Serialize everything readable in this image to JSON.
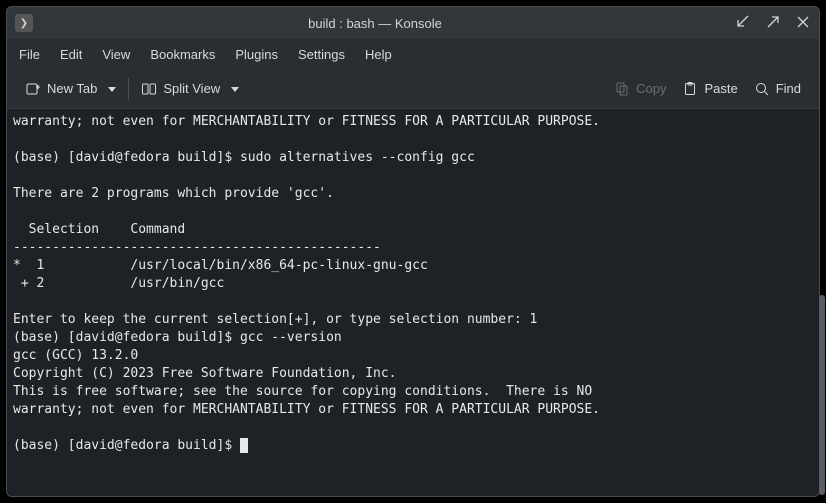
{
  "window": {
    "title": "build : bash — Konsole"
  },
  "menubar": {
    "items": [
      "File",
      "Edit",
      "View",
      "Bookmarks",
      "Plugins",
      "Settings",
      "Help"
    ]
  },
  "toolbar": {
    "new_tab": "New Tab",
    "split_view": "Split View",
    "copy": "Copy",
    "paste": "Paste",
    "find": "Find"
  },
  "terminal": {
    "lines": [
      "warranty; not even for MERCHANTABILITY or FITNESS FOR A PARTICULAR PURPOSE.",
      "",
      "(base) [david@fedora build]$ sudo alternatives --config gcc",
      "",
      "There are 2 programs which provide 'gcc'.",
      "",
      "  Selection    Command",
      "-----------------------------------------------",
      "*  1           /usr/local/bin/x86_64-pc-linux-gnu-gcc",
      " + 2           /usr/bin/gcc",
      "",
      "Enter to keep the current selection[+], or type selection number: 1",
      "(base) [david@fedora build]$ gcc --version",
      "gcc (GCC) 13.2.0",
      "Copyright (C) 2023 Free Software Foundation, Inc.",
      "This is free software; see the source for copying conditions.  There is NO",
      "warranty; not even for MERCHANTABILITY or FITNESS FOR A PARTICULAR PURPOSE.",
      "",
      "(base) [david@fedora build]$ "
    ]
  }
}
